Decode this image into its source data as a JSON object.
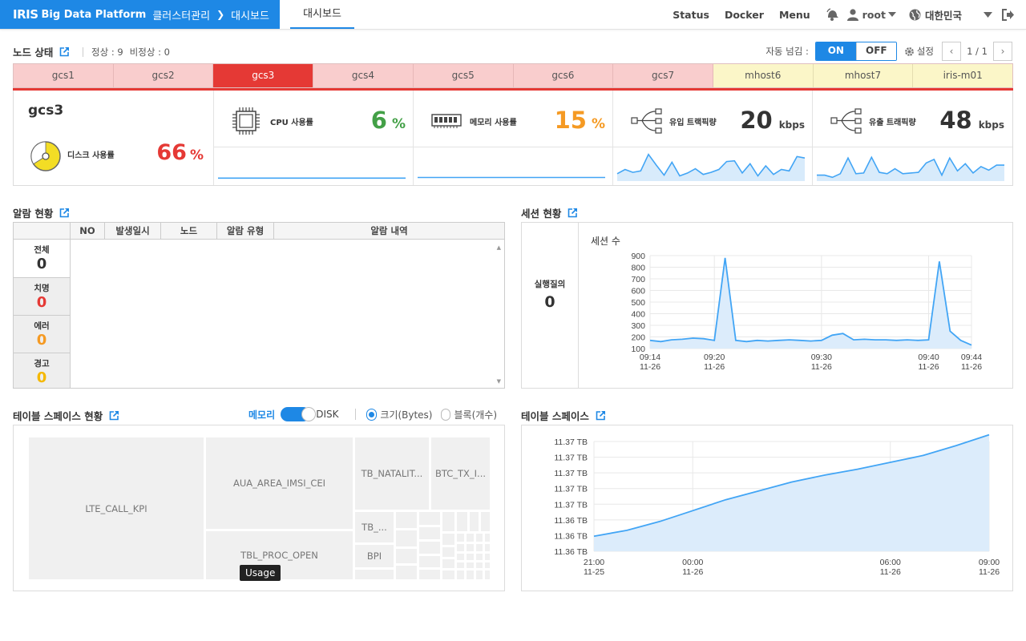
{
  "header": {
    "logo": "IRIS",
    "platform": "Big Data Platform",
    "breadcrumb1": "클러스터관리",
    "breadcrumb2": "대시보드",
    "active_tab": "대시보드",
    "nav": [
      "Status",
      "Docker",
      "Menu"
    ],
    "user": "root",
    "language": "대한민국"
  },
  "node_status": {
    "title": "노드 상태",
    "normal_text": "정상 : 9",
    "abnormal_text": "비정상 : 0",
    "auto_label": "자동 넘김 :",
    "on_label": "ON",
    "off_label": "OFF",
    "settings_label": "설정",
    "page_text": "1 / 1",
    "tabs": [
      {
        "name": "gcs1",
        "state": "red"
      },
      {
        "name": "gcs2",
        "state": "red"
      },
      {
        "name": "gcs3",
        "state": "active"
      },
      {
        "name": "gcs4",
        "state": "red"
      },
      {
        "name": "gcs5",
        "state": "red"
      },
      {
        "name": "gcs6",
        "state": "red"
      },
      {
        "name": "gcs7",
        "state": "red"
      },
      {
        "name": "mhost6",
        "state": "yellow"
      },
      {
        "name": "mhost7",
        "state": "yellow"
      },
      {
        "name": "iris-m01",
        "state": "yellow"
      }
    ],
    "selected": {
      "name": "gcs3",
      "disk_label": "디스크 사용률",
      "disk_value": "66",
      "disk_unit": "%",
      "disk_fraction": 0.66,
      "cpu_label": "CPU 사용률",
      "cpu_value": "6",
      "cpu_unit": "%",
      "mem_label": "메모리 사용률",
      "mem_value": "15",
      "mem_unit": "%",
      "in_label": "유입 트랙픽량",
      "in_value": "20",
      "in_unit": "kbps",
      "out_label": "유출 트래픽량",
      "out_value": "48",
      "out_unit": "kbps"
    },
    "colors": {
      "normal": "#e53935",
      "cpu": "#43a047",
      "mem": "#f59a23",
      "disk": "#e53935",
      "spark": "#42a5f5"
    }
  },
  "alarm": {
    "title": "알람 현황",
    "columns": [
      "NO",
      "발생일시",
      "노드",
      "알람 유형",
      "알람 내역"
    ],
    "counts": [
      {
        "label": "전체",
        "value": "0",
        "color": "#333333"
      },
      {
        "label": "치명",
        "value": "0",
        "color": "#e53935"
      },
      {
        "label": "에러",
        "value": "0",
        "color": "#f59a23"
      },
      {
        "label": "경고",
        "value": "0",
        "color": "#f5b800"
      }
    ]
  },
  "session": {
    "title": "세션 현황",
    "running_label": "실행질의",
    "running_value": "0",
    "chart_data": {
      "type": "line",
      "title": "세션 수",
      "x": [
        "09:14",
        "09:15",
        "09:16",
        "09:17",
        "09:18",
        "09:19",
        "09:20",
        "09:21",
        "09:22",
        "09:23",
        "09:24",
        "09:25",
        "09:26",
        "09:27",
        "09:28",
        "09:29",
        "09:30",
        "09:31",
        "09:32",
        "09:33",
        "09:34",
        "09:35",
        "09:36",
        "09:37",
        "09:38",
        "09:39",
        "09:40",
        "09:41",
        "09:42",
        "09:43",
        "09:44"
      ],
      "values": [
        170,
        160,
        175,
        180,
        190,
        185,
        170,
        880,
        170,
        160,
        170,
        165,
        170,
        175,
        170,
        165,
        170,
        215,
        230,
        175,
        180,
        175,
        175,
        170,
        175,
        170,
        175,
        850,
        250,
        170,
        130
      ],
      "ylim": [
        100,
        900
      ],
      "yticks": [
        100,
        200,
        300,
        400,
        500,
        600,
        700,
        800,
        900
      ],
      "xticks": [
        {
          "time": "09:14",
          "date": "11-26"
        },
        {
          "time": "09:20",
          "date": "11-26"
        },
        {
          "time": "09:30",
          "date": "11-26"
        },
        {
          "time": "09:40",
          "date": "11-26"
        },
        {
          "time": "09:44",
          "date": "11-26"
        }
      ]
    }
  },
  "tablespace_status": {
    "title": "테이블 스페이스 현황",
    "mode_memory": "메모리",
    "mode_disk": "DISK",
    "radio_size": "크기(Bytes)",
    "radio_block": "블록(개수)",
    "tooltip": "Usage",
    "items": [
      "LTE_CALL_KPI",
      "AUA_AREA_IMSI_CEI",
      "TB_NATALIT...",
      "BTC_TX_I...",
      "TB_...",
      "BPI",
      "TBL_PROC_OPEN"
    ]
  },
  "tablespace": {
    "title": "테이블 스페이스",
    "chart_data": {
      "type": "area",
      "x": [
        "21:00 11-25",
        "00:00 11-26",
        "06:00 11-26",
        "09:00 11-26"
      ],
      "y_tick_labels": [
        "11.37 TB",
        "11.37 TB",
        "11.37 TB",
        "11.37 TB",
        "11.37 TB",
        "11.36 TB",
        "11.36 TB",
        "11.36 TB"
      ],
      "xticks": [
        {
          "time": "21:00",
          "date": "11-25"
        },
        {
          "time": "00:00",
          "date": "11-26"
        },
        {
          "time": "06:00",
          "date": "11-26"
        },
        {
          "time": "09:00",
          "date": "11-26"
        }
      ],
      "trend": "increasing"
    }
  },
  "sparklines": {
    "cpu": [
      2,
      2,
      2,
      2,
      2,
      2,
      2,
      2,
      2,
      2,
      2,
      2,
      2,
      2,
      2,
      2,
      2,
      2,
      2,
      2
    ],
    "mem": [
      3,
      3,
      3,
      3,
      3,
      3,
      3,
      3,
      3,
      3,
      3,
      3,
      3,
      3,
      3,
      3,
      3,
      3,
      3,
      3
    ],
    "in": [
      8,
      14,
      10,
      12,
      35,
      20,
      6,
      24,
      5,
      9,
      15,
      7,
      10,
      14,
      25,
      26,
      9,
      22,
      5,
      19,
      7,
      14,
      12,
      32,
      30
    ],
    "out": [
      6,
      6,
      3,
      8,
      30,
      8,
      9,
      31,
      10,
      8,
      15,
      8,
      9,
      10,
      23,
      28,
      6,
      30,
      12,
      22,
      9,
      18,
      13,
      20,
      20
    ]
  }
}
